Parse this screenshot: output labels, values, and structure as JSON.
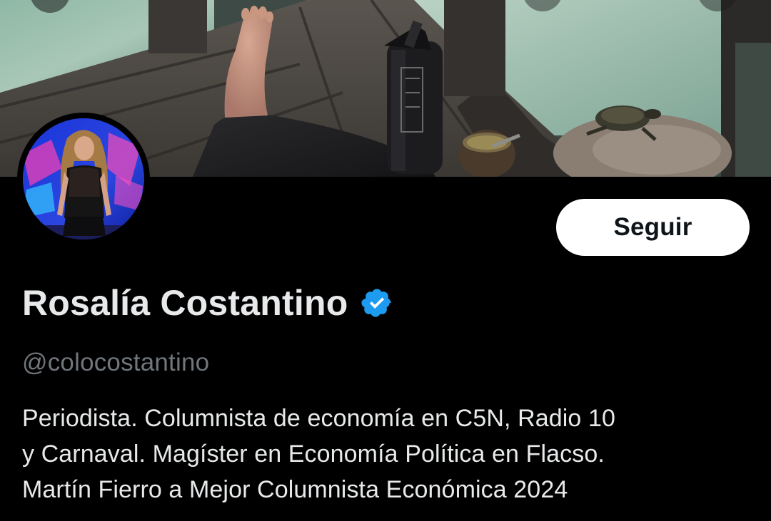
{
  "profile": {
    "display_name": "Rosalía Costantino",
    "verified": true,
    "handle": "@colocostantino",
    "bio_lines": [
      "Periodista. Columnista de economía en C5N, Radio 10",
      "y Carnaval. Magíster en Economía Política en Flacso.",
      "Martín Fierro a Mejor Columnista Económica 2024"
    ]
  },
  "actions": {
    "follow_label": "Seguir"
  },
  "colors": {
    "background": "#000000",
    "primary_text": "#e7e9ea",
    "secondary_text": "#71767b",
    "verified_badge": "#1d9bf0",
    "follow_button_bg": "#ffffff",
    "follow_button_text": "#0f1419"
  },
  "icons": {
    "verified": "verified-check-badge-icon"
  }
}
